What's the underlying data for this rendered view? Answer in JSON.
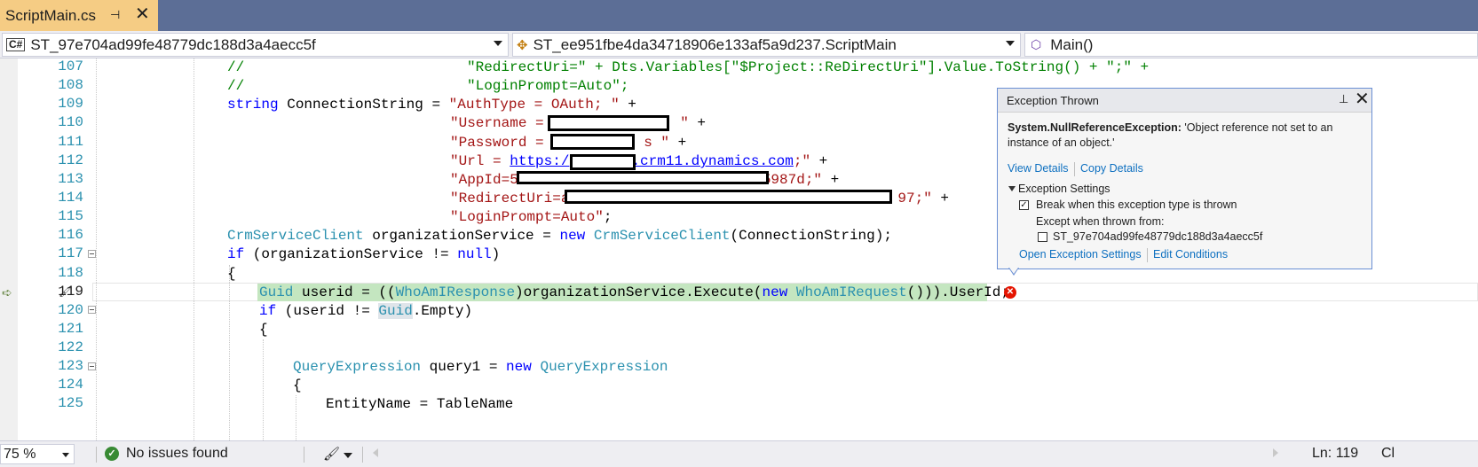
{
  "tab": {
    "title": "ScriptMain.cs",
    "pin_glyph": "⊣",
    "close_glyph": "✕"
  },
  "nav": {
    "project_badge": "C#",
    "project": "ST_97e704ad99fe48779dc188d3a4aecc5f",
    "class": "ST_ee951fbe4da34718906e133af5a9d237.ScriptMain",
    "member": "Main()"
  },
  "editor": {
    "line_numbers": [
      "107",
      "108",
      "109",
      "110",
      "111",
      "112",
      "113",
      "114",
      "115",
      "116",
      "117",
      "118",
      "119",
      "120",
      "121",
      "122",
      "123",
      "124",
      "125"
    ],
    "code": {
      "l107_a": "//",
      "l107_b": "\"RedirectUri=\" + Dts.Variables[\"$Project::ReDirectUri\"].Value.ToString() + \";\" +",
      "l108_a": "//",
      "l108_b": "\"LoginPrompt=Auto\";",
      "l109_kw": "string",
      "l109_mid": " ConnectionString = ",
      "l109_str": "\"AuthType = OAuth; \"",
      "l109_end": " +",
      "l110_str": "\"Username = ",
      "l110_tail": "\"",
      "l110_end": " +",
      "l111_str": "\"Password = ",
      "l111_tail": "s \"",
      "l111_end": " +",
      "l112_str1": "\"Url = ",
      "l112_url1": "https:/",
      "l112_url2": ".crm11.dynamics.com",
      "l112_str2": ";\"",
      "l112_end": " +",
      "l113_str": "\"AppId=5",
      "l113_tail": "5987d;\"",
      "l113_end": " +",
      "l114_str": "\"RedirectUri=a",
      "l114_tail": "97;\"",
      "l114_end": " +",
      "l115_str": "\"LoginPrompt=Auto\"",
      "l115_end": ";",
      "l116_ty1": "CrmServiceClient",
      "l116_mid": " organizationService = ",
      "l116_kw": "new",
      "l116_ty2": "CrmServiceClient",
      "l116_end": "(ConnectionString);",
      "l117_kw": "if",
      "l117_mid": " (organizationService != ",
      "l117_kw2": "null",
      "l117_end": ")",
      "l118": "{",
      "l119_ty": "Guid",
      "l119_a": " userid = ((",
      "l119_ty2": "WhoAmIResponse",
      "l119_b": ")organizationService.Execute(",
      "l119_kw": "new",
      "l119_ty3": "WhoAmIRequest",
      "l119_c": "())).UserId;",
      "l120_kw": "if",
      "l120_a": " (userid != ",
      "l120_ty": "Guid",
      "l120_b": ".Empty)",
      "l121": "{",
      "l123_ty": "QueryExpression",
      "l123_a": " query1 = ",
      "l123_kw": "new",
      "l123_ty2": "QueryExpression",
      "l124": "{",
      "l125_a": "EntityName = TableName"
    }
  },
  "exception": {
    "title": "Exception Thrown",
    "pin_glyph": "📌",
    "close_glyph": "✕",
    "type": "System.NullReferenceException:",
    "message": " 'Object reference not set to an instance of an object.'",
    "view_details": "View Details",
    "copy_details": "Copy Details",
    "settings_header": "Exception Settings",
    "break_label": "Break when this exception type is thrown",
    "break_checked": true,
    "except_label": "Except when thrown from:",
    "except_item": "ST_97e704ad99fe48779dc188d3a4aecc5f",
    "except_checked": false,
    "open_settings": "Open Exception Settings",
    "edit_conditions": "Edit Conditions"
  },
  "status": {
    "zoom": "75 %",
    "issues": "No issues found",
    "line": "Ln: 119",
    "col": "Cl"
  }
}
